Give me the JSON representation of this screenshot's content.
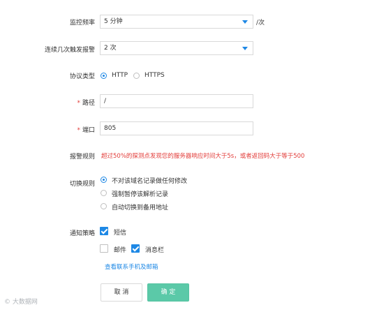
{
  "form": {
    "monitor_frequency": {
      "label": "监控频率",
      "value": "5 分钟",
      "suffix": "/次"
    },
    "consecutive_alarm": {
      "label": "连续几次触发报警",
      "value": "2 次"
    },
    "protocol": {
      "label": "协议类型",
      "options": [
        "HTTP",
        "HTTPS"
      ],
      "selected": "HTTP"
    },
    "path": {
      "required_mark": "*",
      "label": "路径",
      "value": "/"
    },
    "port": {
      "required_mark": "*",
      "label": "端口",
      "value": "805"
    },
    "alarm_rule": {
      "label": "报警规则",
      "text": "超过50%的探测点发现您的服务器响应时间大于5s，或者返回码大于等于500"
    },
    "switch_rule": {
      "label": "切换规则",
      "options": [
        "不对该域名记录做任何修改",
        "强制暂停该解析记录",
        "自动切换到备用地址"
      ],
      "selected": "不对该域名记录做任何修改"
    },
    "notify": {
      "label": "通知策略",
      "options": [
        {
          "label": "短信",
          "checked": true
        },
        {
          "label": "邮件",
          "checked": false
        },
        {
          "label": "消息栏",
          "checked": true
        }
      ],
      "link": "查看联系手机及邮箱"
    },
    "buttons": {
      "cancel": "取 消",
      "confirm": "确 定"
    }
  },
  "watermark": "© 大数据网"
}
